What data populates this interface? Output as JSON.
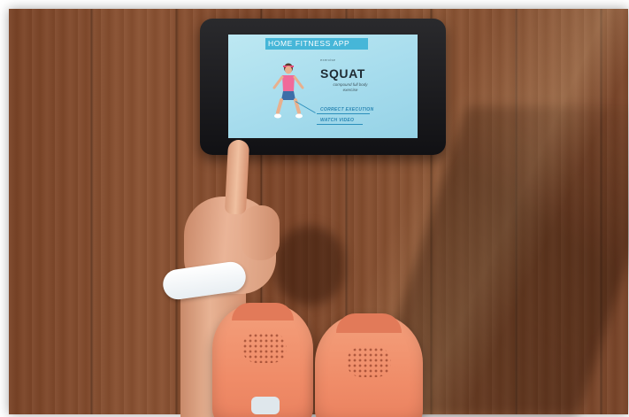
{
  "app": {
    "title": "HOME FITNESS APP",
    "exercise_label": "exercise",
    "exercise_name": "SQUAT",
    "exercise_desc": "compound full body exercise",
    "links": [
      {
        "label": "CORRECT EXECUTION"
      },
      {
        "label": "WATCH VIDEO"
      }
    ]
  },
  "colors": {
    "screen_bg": "#a6dced",
    "title_bar": "#46b6d8",
    "link": "#2a86b3",
    "shoe": "#f08c68",
    "wristband": "#ffffff",
    "floor": "#7d4528"
  },
  "icons": [
    "squat-figure-illustration"
  ]
}
